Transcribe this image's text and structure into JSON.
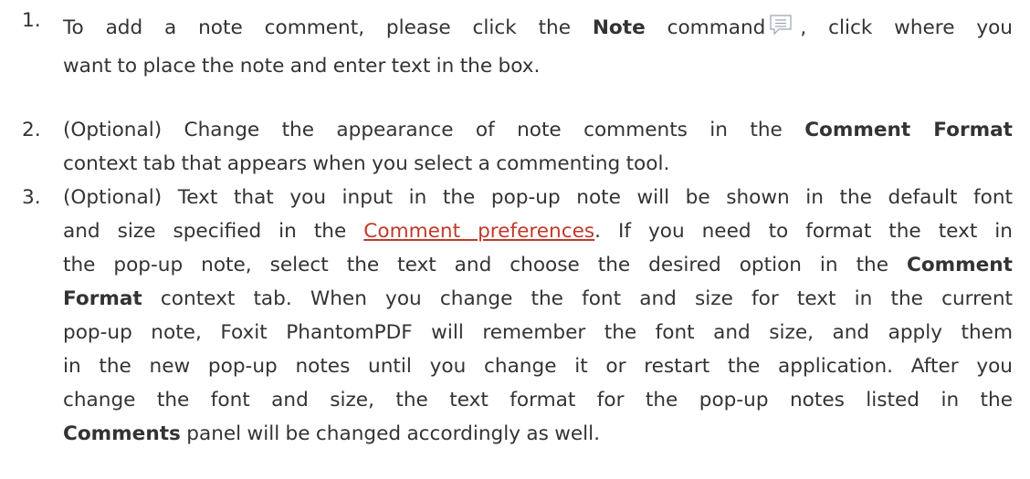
{
  "steps": [
    {
      "number": "1.",
      "line1_a": "To add a note comment, please click the ",
      "line1_b": "Note",
      "line1_c": " command",
      "line1_d": ", click where you",
      "line2": "want to place the note and enter text in the box."
    },
    {
      "number": "2.",
      "line1_a": "(Optional) Change the appearance of note comments in the ",
      "line1_b": "Comment Format",
      "line2": "context tab that appears when you select a commenting tool."
    },
    {
      "number": "3.",
      "line1": "(Optional) Text that you input in the pop-up note will be shown in the default font",
      "line2_a": "and size specified in the ",
      "line2_link": "Comment preferences",
      "line2_b": ". If you need to format the text in",
      "line3_a": "the pop-up note, select the text and choose the desired option in the ",
      "line3_b": "Comment",
      "line4_a": "Format",
      "line4_b": " context tab. When you change the font and size for text in the current",
      "line5": "pop-up note, Foxit PhantomPDF will remember the font and size, and apply them",
      "line6": "in the new pop-up notes until you change it or restart the application. After you",
      "line7": "change the font and size, the text format for the pop-up notes listed in the",
      "line8_a": "Comments",
      "line8_b": " panel will be changed accordingly as well."
    }
  ]
}
